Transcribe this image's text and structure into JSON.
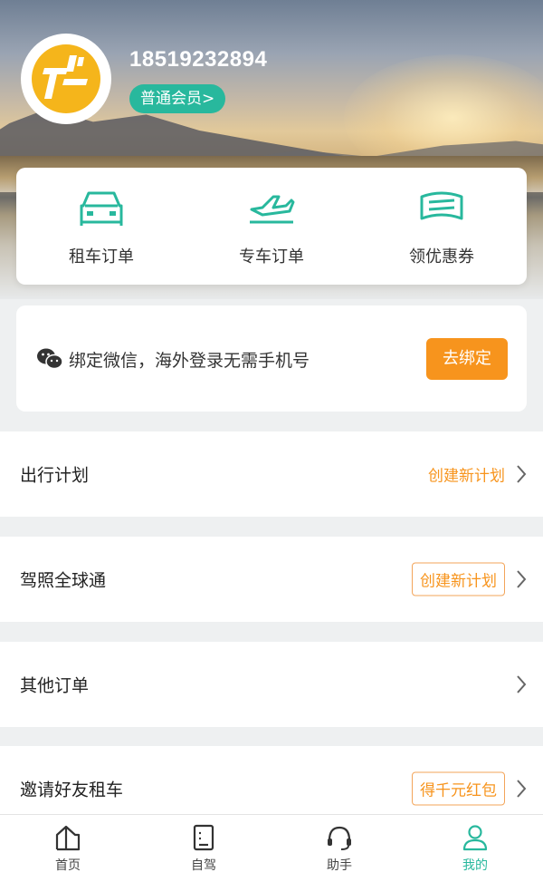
{
  "profile": {
    "phone": "18519232894",
    "member_label": "普通会员>"
  },
  "orders": [
    {
      "label": "租车订单",
      "icon": "car-icon"
    },
    {
      "label": "专车订单",
      "icon": "plane-icon"
    },
    {
      "label": "领优惠券",
      "icon": "coupon-icon"
    }
  ],
  "wechat": {
    "text": "绑定微信，海外登录无需手机号",
    "button": "去绑定",
    "icon": "wechat-icon"
  },
  "rows": [
    {
      "title": "出行计划",
      "action": "创建新计划",
      "boxed": false
    },
    {
      "title": "驾照全球通",
      "action": "创建新计划",
      "boxed": true
    },
    {
      "title": "其他订单",
      "action": "",
      "boxed": false
    },
    {
      "title": "邀请好友租车",
      "action": "得千元红包",
      "boxed": true
    }
  ],
  "tabs": [
    {
      "label": "首页",
      "icon": "home-icon",
      "active": false
    },
    {
      "label": "自驾",
      "icon": "notebook-icon",
      "active": false
    },
    {
      "label": "助手",
      "icon": "headset-icon",
      "active": false
    },
    {
      "label": "我的",
      "icon": "user-icon",
      "active": true
    }
  ],
  "colors": {
    "accent": "#28b89d",
    "orange": "#f7941d",
    "logo": "#f5b51b"
  }
}
